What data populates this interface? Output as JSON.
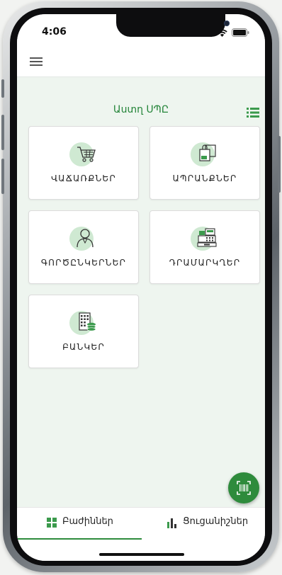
{
  "status_bar": {
    "time": "4:06",
    "icons": [
      "signal-icon",
      "wifi-icon",
      "battery-icon"
    ]
  },
  "header": {
    "menu_icon": "hamburger-menu-icon",
    "company_name": "Աստղ ՍՊԸ",
    "view_toggle_icon": "list-view-icon"
  },
  "tiles": [
    {
      "label": "ՎԱՃԱՌՔՆԵՐ",
      "icon": "shopping-cart-icon"
    },
    {
      "label": "ԱՊՐԱՆՔՆԵՐ",
      "icon": "product-box-icon"
    },
    {
      "label": "ԳՈՐԾԸՆԿԵՐՆԵՐ",
      "icon": "person-icon"
    },
    {
      "label": "ԴՐԱՄԱՐԿՂԵՐ",
      "icon": "cash-register-icon"
    },
    {
      "label": "ԲԱՆԿԵՐ",
      "icon": "bank-icon"
    }
  ],
  "fab": {
    "icon": "barcode-scan-icon"
  },
  "tab_bar": {
    "tabs": [
      {
        "label": "Բաժիններ",
        "icon": "grid-icon",
        "active": true
      },
      {
        "label": "Ցուցանիշներ",
        "icon": "bar-chart-icon",
        "active": false
      }
    ]
  },
  "colors": {
    "accent": "#2e8b3c",
    "title": "#25853a",
    "icon_circle": "#cfe9d2",
    "background": "#eef5ef"
  }
}
